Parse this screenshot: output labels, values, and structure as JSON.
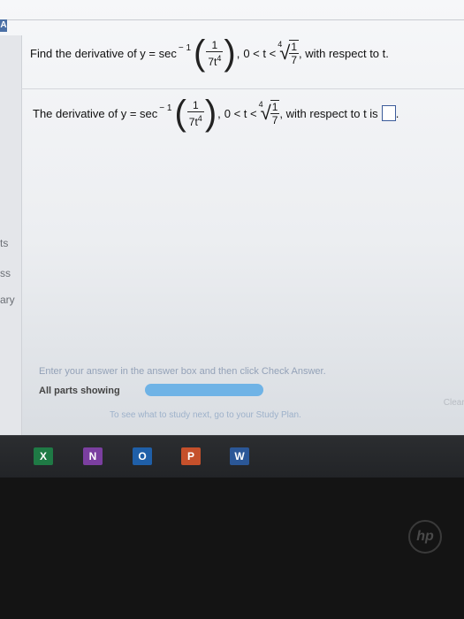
{
  "problem": {
    "prefix": "Find the derivative of y = sec",
    "inv_sup": "− 1",
    "frac_num": "1",
    "frac_den": "7t",
    "frac_den_exp": "4",
    "comma": ",",
    "condition": "0 < t <",
    "root_index": "4",
    "root_num": "1",
    "root_den": "7",
    "suffix": ", with respect to t."
  },
  "answer": {
    "prefix": "The derivative of y = sec",
    "inv_sup": "− 1",
    "frac_num": "1",
    "frac_den": "7t",
    "frac_den_exp": "4",
    "comma": ",",
    "condition": "0 < t <",
    "root_index": "4",
    "root_num": "1",
    "root_den": "7",
    "suffix": ", with respect to t is",
    "trailing": "."
  },
  "left_rail": {
    "label1": "ts",
    "label2": "ss",
    "label3": "ary"
  },
  "footer": {
    "instruction": "Enter your answer in the answer box and then click Check Answer.",
    "all_parts": "All parts showing",
    "progress": 1.0,
    "study_next": "To see what to study next, go to your Study Plan.",
    "clear_all": "Clear All"
  },
  "taskbar": {
    "excel": "X",
    "onenote": "N",
    "outlook": "O",
    "powerpoint": "P",
    "word": "W"
  },
  "colors": {
    "excel": "#1f7a45",
    "onenote": "#7b3fa0",
    "outlook": "#1f5fa8",
    "powerpoint": "#c5502b",
    "word": "#2b5797"
  }
}
